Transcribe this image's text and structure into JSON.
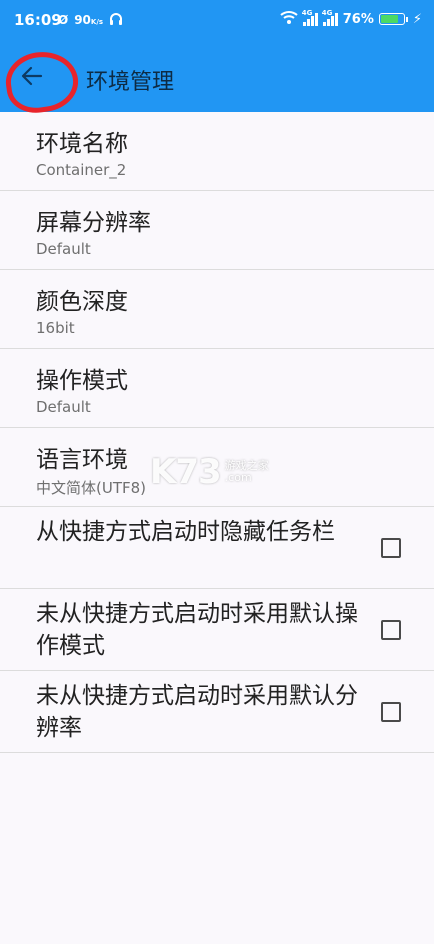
{
  "status_bar": {
    "time": "16:09",
    "speed": "90",
    "speed_unit": "K/s",
    "battery": "76%",
    "sim1_label": "4G",
    "sim2_label": "4G"
  },
  "toolbar": {
    "title": "环境管理"
  },
  "settings": {
    "items": [
      {
        "title": "环境名称",
        "value": "Container_2"
      },
      {
        "title": "屏幕分辨率",
        "value": "Default"
      },
      {
        "title": "颜色深度",
        "value": "16bit"
      },
      {
        "title": "操作模式",
        "value": "Default"
      },
      {
        "title": "语言环境",
        "value": "中文简体(UTF8)"
      }
    ],
    "checks": [
      {
        "label": "从快捷方式启动时隐藏任务栏",
        "checked": false
      },
      {
        "label": "未从快捷方式启动时采用默认操作模式",
        "checked": false
      },
      {
        "label": "未从快捷方式启动时采用默认分辨率",
        "checked": false
      }
    ]
  },
  "watermark": {
    "logo": "K73",
    "line1": "游戏之家",
    "line2": ".com"
  },
  "colors": {
    "appbar": "#2196f3",
    "background": "#faf8fc",
    "annotation": "#e8242b"
  }
}
